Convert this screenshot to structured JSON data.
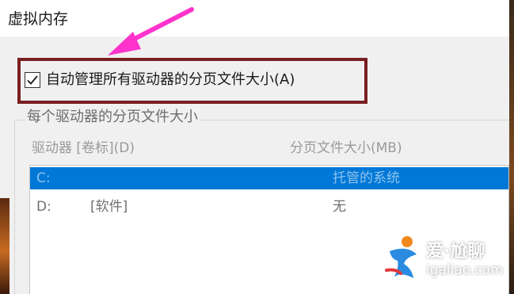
{
  "window": {
    "title": "虚拟内存"
  },
  "auto_manage": {
    "label": "自动管理所有驱动器的分页文件大小(A)",
    "checked": true
  },
  "group": {
    "title": "每个驱动器的分页文件大小",
    "columns": {
      "drive": "驱动器 [卷标](D)",
      "size": "分页文件大小(MB)"
    },
    "rows": [
      {
        "drive": "C:",
        "label": "",
        "size": "托管的系统",
        "selected": true
      },
      {
        "drive": "D:",
        "label": "[软件]",
        "size": "无",
        "selected": false
      }
    ]
  },
  "watermark": {
    "name": "爱·尬聊",
    "url": "igaliao.com"
  },
  "colors": {
    "highlight_border": "#7a1f20",
    "arrow": "#ff33cc",
    "selection": "#0078d7"
  }
}
